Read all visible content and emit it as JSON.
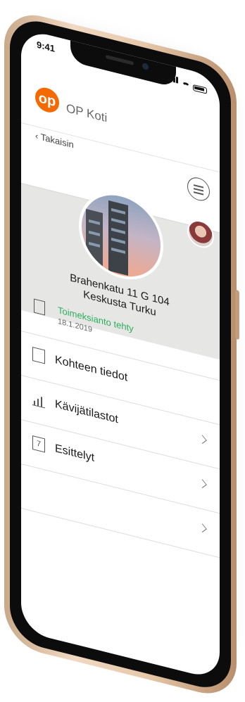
{
  "status_bar": {
    "time": "9:41"
  },
  "header": {
    "logo": "op",
    "title": "OP Koti"
  },
  "nav": {
    "back_label": "Takaisin"
  },
  "property": {
    "address_line1": "Brahenkatu 11 G 104",
    "address_line2": "Keskusta Turku",
    "status": "Toimeksianto tehty",
    "status_date": "18.1.2019",
    "status_color": "#2cae5f"
  },
  "menu": {
    "items": [
      {
        "label": "Kohteen tiedot",
        "icon": "document-icon"
      },
      {
        "label": "Kävijätilastot",
        "icon": "bar-chart-icon"
      },
      {
        "label": "Esittelyt",
        "icon": "calendar-icon",
        "icon_text": "7"
      }
    ]
  },
  "colors": {
    "brand": "#f56a00",
    "frame": "#e6c9ab"
  }
}
